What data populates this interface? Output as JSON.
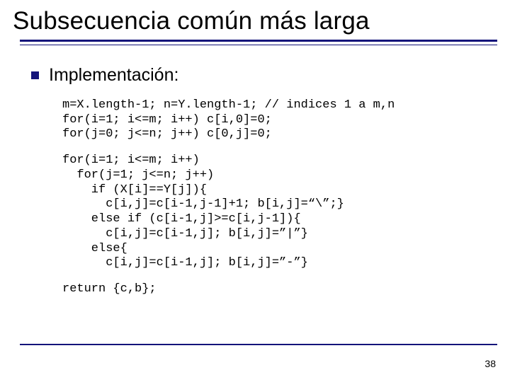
{
  "title": "Subsecuencia común más larga",
  "bullet": "Implementación:",
  "code": {
    "block1": "m=X.length-1; n=Y.length-1; // indices 1 a m,n\nfor(i=1; i<=m; i++) c[i,0]=0;\nfor(j=0; j<=n; j++) c[0,j]=0;",
    "block2": "for(i=1; i<=m; i++)\n  for(j=1; j<=n; j++)\n    if (X[i]==Y[j]){\n      c[i,j]=c[i-1,j-1]+1; b[i,j]=“\\”;}\n    else if (c[i-1,j]>=c[i,j-1]){\n      c[i,j]=c[i-1,j]; b[i,j]=”|”}\n    else{\n      c[i,j]=c[i-1,j]; b[i,j]=”-”}",
    "block3": "return {c,b};"
  },
  "page": "38"
}
